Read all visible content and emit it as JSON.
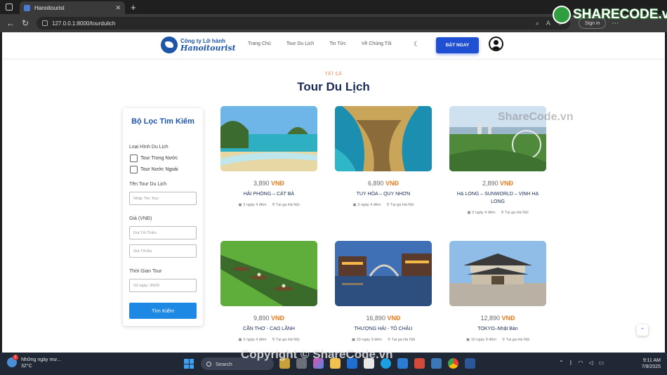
{
  "browser": {
    "tab_title": "Hanoitourist",
    "url": "127.0.0.1:8000/tourdulich",
    "signin_label": "Sign in"
  },
  "navbar": {
    "logo_top": "Công ty Lữ hành",
    "logo_bottom": "Hanoitourist",
    "menu": [
      "Trang Chủ",
      "Tour Du Lịch",
      "Tin Tức",
      "Về Chúng Tôi"
    ],
    "book_button": "ĐẶT NGAY"
  },
  "section": {
    "kicker": "TẤT CẢ",
    "title": "Tour Du Lịch"
  },
  "filter": {
    "title": "Bộ Lọc Tìm Kiếm",
    "type_label": "Loại Hình Du Lịch",
    "type_options": [
      "Tour Trong Nước",
      "Tour Nước Ngoài"
    ],
    "name_label": "Tên Tour Du Lịch",
    "name_placeholder": "Nhập Tên Tour",
    "price_label": "Giá (VNĐ)",
    "price_min_placeholder": "Giá Tối Thiểu",
    "price_max_placeholder": "Giá Tối Đa",
    "duration_label": "Thời Gian Tour",
    "duration_placeholder": "Số ngày: 3N2D",
    "search_button": "Tìm Kiếm"
  },
  "tours": [
    {
      "price": "3,890",
      "currency": "VNĐ",
      "name": "HẢI PHÒNG – CÁT BÀ",
      "duration": "3 ngày 4 đêm",
      "depart": "Tại ga Hà Nội"
    },
    {
      "price": "6,890",
      "currency": "VNĐ",
      "name": "TUY HÒA – QUY NHƠN",
      "duration": "3 ngày 4 đêm",
      "depart": "Tại ga Hà Nội"
    },
    {
      "price": "2,890",
      "currency": "VNĐ",
      "name": "HẠ LONG – SUNWORLD – VỊNH HẠ LONG",
      "duration": "3 ngày 4 đêm",
      "depart": "Tại ga Hà Nội"
    },
    {
      "price": "9,890",
      "currency": "VNĐ",
      "name": "CẦN THƠ - CAO LÃNH",
      "duration": "3 ngày 4 đêm",
      "depart": "Tại ga Hà Nội"
    },
    {
      "price": "16,890",
      "currency": "VNĐ",
      "name": "THƯỢNG HẢI - TÔ CHÂU",
      "duration": "10 ngày 9 đêm",
      "depart": "Tại ga Hà Nội"
    },
    {
      "price": "12,890",
      "currency": "VNĐ",
      "name": "TOKYO–Nhật Bản",
      "duration": "10 ngày 9 đêm",
      "depart": "Tại ga Hà Nội"
    }
  ],
  "watermarks": {
    "logo": "SHARECODE.vn",
    "middle": "ShareCode.vn",
    "bottom": "Copyright © ShareCode.vn"
  },
  "taskbar": {
    "weather_title": "Những ngày mư...",
    "weather_temp": "32°C",
    "weather_badge": "1",
    "search_label": "Search",
    "time": "9:11 AM",
    "date": "7/9/2025"
  },
  "colors": {
    "primary": "#1f4fd3",
    "accent_orange": "#e67e22",
    "title_navy": "#1a2b58",
    "logo_blue": "#1d55a8"
  }
}
